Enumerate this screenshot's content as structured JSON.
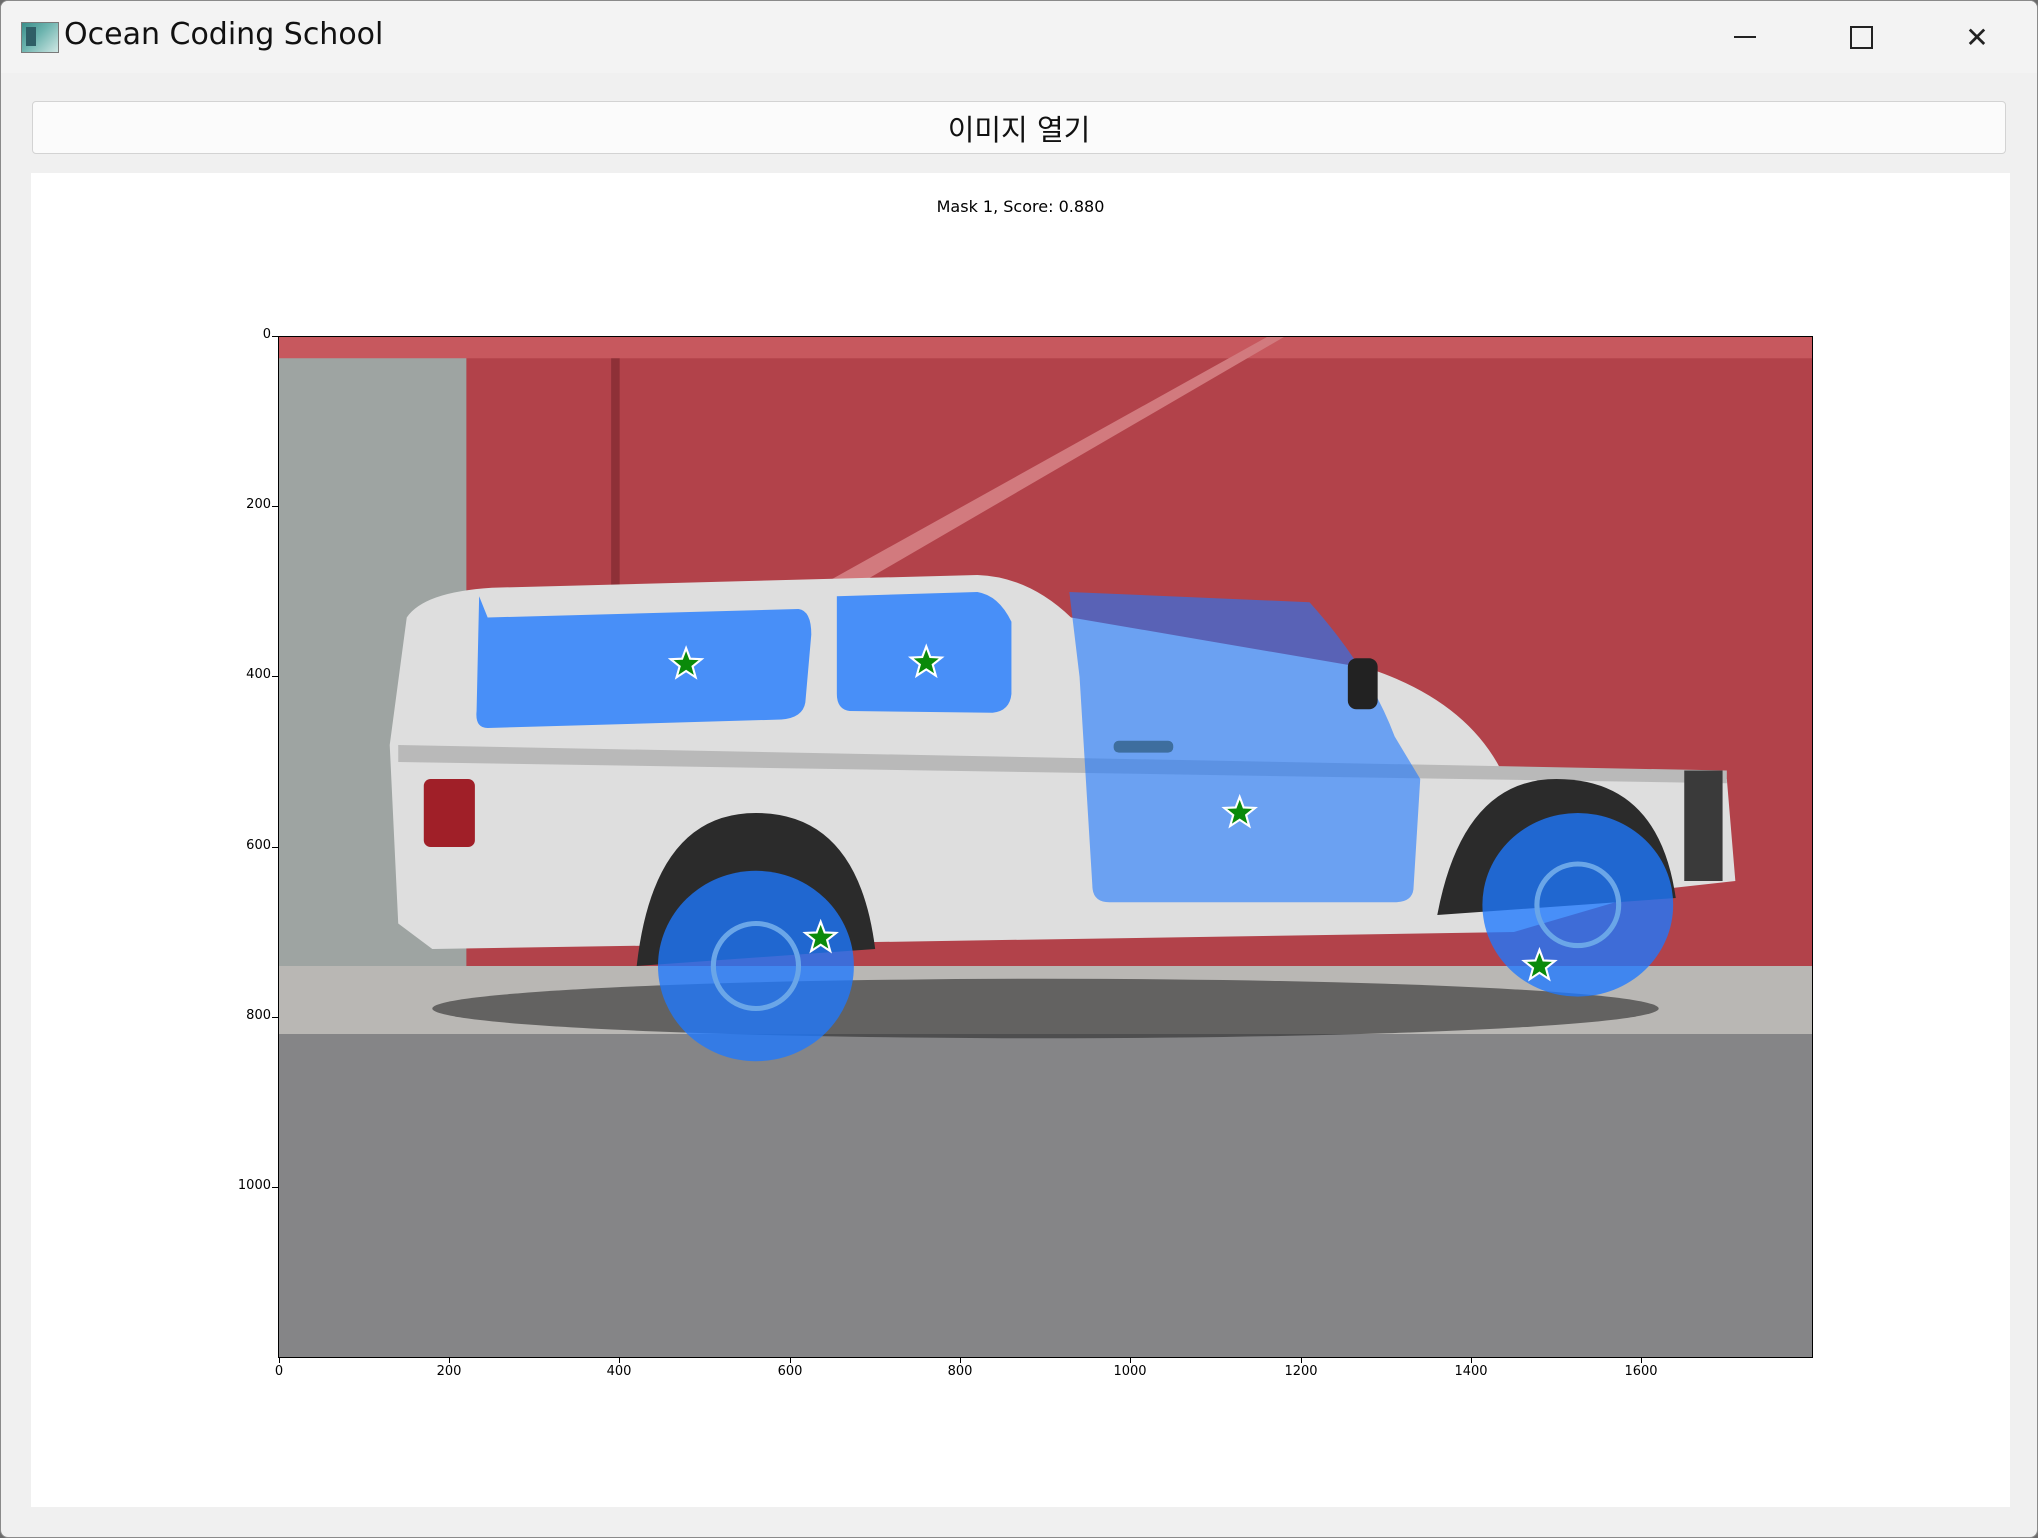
{
  "window": {
    "title": "Ocean Coding School",
    "icon": "app-image-icon",
    "controls": [
      "minimize-icon",
      "maximize-icon",
      "close-icon"
    ]
  },
  "toolbar": {
    "open_image_label": "이미지 열기"
  },
  "figure": {
    "title": "Mask 1, Score: 0.880",
    "y_ticks": [
      "0",
      "200",
      "400",
      "600",
      "800",
      "1000"
    ],
    "x_ticks": [
      "0",
      "200",
      "400",
      "600",
      "800",
      "1000",
      "1200",
      "1400",
      "1600"
    ],
    "image_extent": {
      "width": 1800,
      "height": 1200
    },
    "mask_color": "#1e78ff",
    "point_color": "#0a8a0a",
    "prompt_points": [
      {
        "x": 478,
        "y": 385
      },
      {
        "x": 760,
        "y": 383
      },
      {
        "x": 1128,
        "y": 560
      },
      {
        "x": 636,
        "y": 707
      },
      {
        "x": 1480,
        "y": 740
      }
    ]
  }
}
